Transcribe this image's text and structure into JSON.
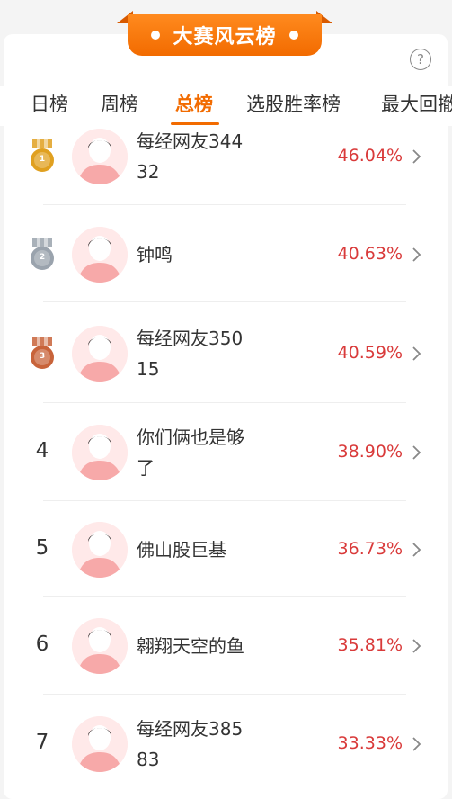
{
  "banner": {
    "title": "大赛风云榜"
  },
  "help_icon": "?",
  "tabs": [
    "日榜",
    "周榜",
    "总榜",
    "选股胜率榜",
    "最大回撤"
  ],
  "active_tab": 2,
  "rows": [
    {
      "rank": "1",
      "medal": "gold",
      "name": "每经网友34432",
      "pct": "46.04%"
    },
    {
      "rank": "2",
      "medal": "silver",
      "name": "钟鸣",
      "pct": "40.63%"
    },
    {
      "rank": "3",
      "medal": "bronze",
      "name": "每经网友35015",
      "pct": "40.59%"
    },
    {
      "rank": "4",
      "medal": "",
      "name": "你们俩也是够了",
      "pct": "38.90%"
    },
    {
      "rank": "5",
      "medal": "",
      "name": "佛山股巨基",
      "pct": "36.73%"
    },
    {
      "rank": "6",
      "medal": "",
      "name": "翱翔天空的鱼",
      "pct": "35.81%"
    },
    {
      "rank": "7",
      "medal": "",
      "name": "每经网友38583",
      "pct": "33.33%"
    }
  ],
  "colors": {
    "accent": "#f26b00",
    "up": "#d93a3a",
    "gold": "#e0a020",
    "silver": "#9aa3ad",
    "bronze": "#c8633a"
  }
}
